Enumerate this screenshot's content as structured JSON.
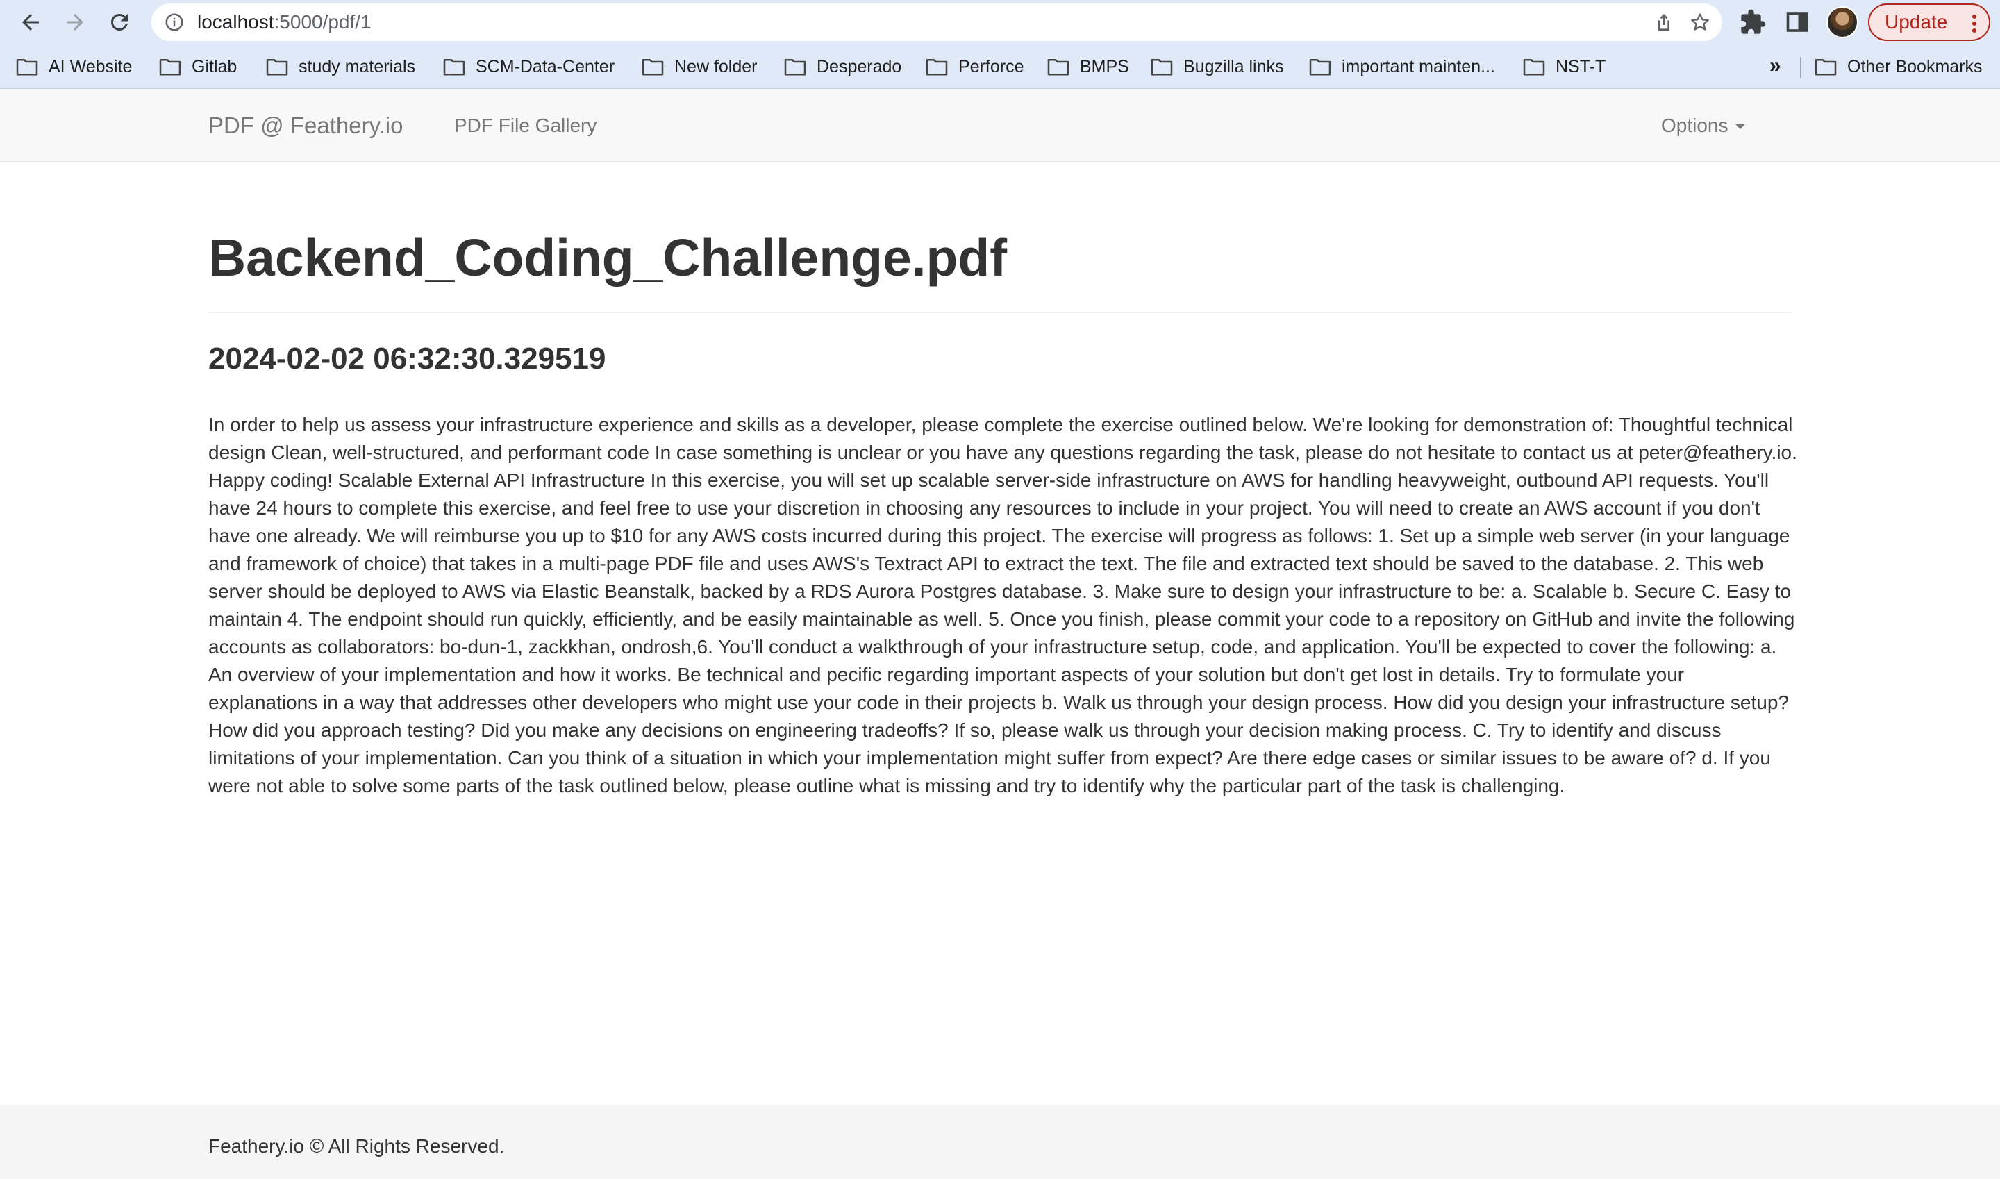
{
  "browser": {
    "url_host": "localhost",
    "url_path": ":5000/pdf/1",
    "update_label": "Update",
    "bookmarks": [
      {
        "label": "AI Website"
      },
      {
        "label": "Gitlab"
      },
      {
        "label": "study materials"
      },
      {
        "label": "SCM-Data-Center"
      },
      {
        "label": "New folder"
      },
      {
        "label": "Desperado"
      },
      {
        "label": "Perforce"
      },
      {
        "label": "BMPS"
      },
      {
        "label": "Bugzilla links"
      },
      {
        "label": "important mainten..."
      },
      {
        "label": "NST-T"
      }
    ],
    "overflow_label": "»",
    "other_bookmarks": "Other Bookmarks",
    "colors": {
      "chrome_bg": "#dfe9f7",
      "update_accent": "#b3261e"
    }
  },
  "navbar": {
    "brand": "PDF @ Feathery.io",
    "gallery_link": "PDF File Gallery",
    "options_label": "Options"
  },
  "main": {
    "title": "Backend_Coding_Challenge.pdf",
    "date": "2024-02-02 06:32:30.329519",
    "text": "In order to help us assess your infrastructure experience and skills as a developer, please complete the exercise outlined below. We're looking for demonstration of: Thoughtful technical design Clean, well-structured, and performant code In case something is unclear or you have any questions regarding the task, please do not hesitate to contact us at peter@feathery.io. Happy coding! Scalable External API Infrastructure In this exercise, you will set up scalable server-side infrastructure on AWS for handling heavyweight, outbound API requests. You'll have 24 hours to complete this exercise, and feel free to use your discretion in choosing any resources to include in your project. You will need to create an AWS account if you don't have one already. We will reimburse you up to $10 for any AWS costs incurred during this project. The exercise will progress as follows: 1. Set up a simple web server (in your language and framework of choice) that takes in a multi-page PDF file and uses AWS's Textract API to extract the text. The file and extracted text should be saved to the database. 2. This web server should be deployed to AWS via Elastic Beanstalk, backed by a RDS Aurora Postgres database. 3. Make sure to design your infrastructure to be: a. Scalable b. Secure C. Easy to maintain 4. The endpoint should run quickly, efficiently, and be easily maintainable as well. 5. Once you finish, please commit your code to a repository on GitHub and invite the following accounts as collaborators: bo-dun-1, zackkhan, ondrosh,6. You'll conduct a walkthrough of your infrastructure setup, code, and application. You'll be expected to cover the following: a. An overview of your implementation and how it works. Be technical and pecific regarding important aspects of your solution but don't get lost in details. Try to formulate your explanations in a way that addresses other developers who might use your code in their projects b. Walk us through your design process. How did you design your infrastructure setup? How did you approach testing? Did you make any decisions on engineering tradeoffs? If so, please walk us through your decision making process. C. Try to identify and discuss limitations of your implementation. Can you think of a situation in which your implementation might suffer from expect? Are there edge cases or similar issues to be aware of? d. If you were not able to solve some parts of the task outlined below, please outline what is missing and try to identify why the particular part of the task is challenging."
  },
  "footer": {
    "text": "Feathery.io © All Rights Reserved."
  }
}
